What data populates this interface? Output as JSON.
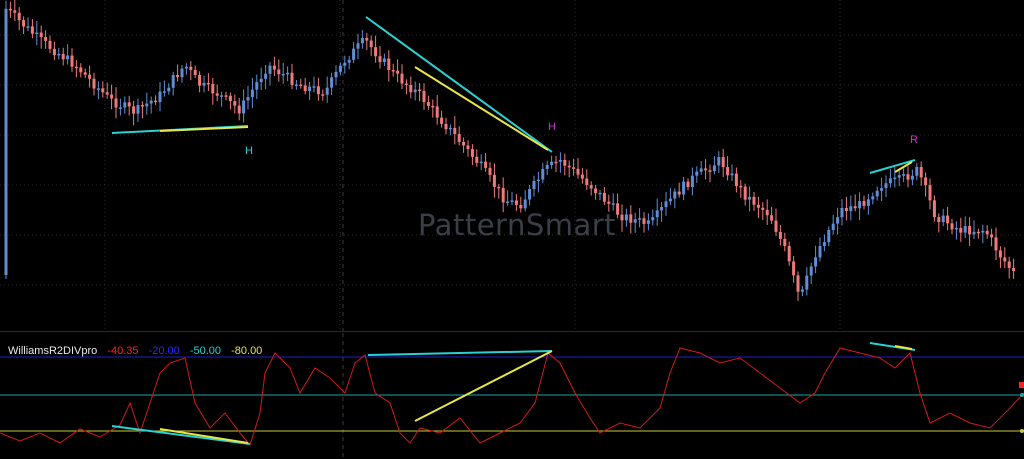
{
  "watermark": "PatternSmart",
  "indicator": {
    "name": "WilliamsR2DIVpro",
    "values": [
      {
        "text": "-40.35",
        "color": "#ff2020"
      },
      {
        "text": "-20.00",
        "color": "#2a2aff"
      },
      {
        "text": "-50.00",
        "color": "#2ad1d1"
      },
      {
        "text": "-80.00",
        "color": "#e6e64a"
      }
    ]
  },
  "colors": {
    "up": "#5f8ed6",
    "down": "#f07a7a",
    "cyan": "#2ad1d1",
    "yellow": "#e6e64a",
    "magenta": "#d02fd0",
    "wr_line": "#d11a1a",
    "level_high": "#1e1ec8",
    "level_mid": "#1aa6a6",
    "level_low": "#c9c93a"
  },
  "chart_data": [
    {
      "type": "candlestick",
      "annotations": [
        {
          "text": "H",
          "color": "#2ad1d1"
        },
        {
          "text": "H",
          "color": "#d02fd0"
        },
        {
          "text": "R",
          "color": "#d02fd0"
        }
      ],
      "divergence_lines": [
        {
          "color": "#2ad1d1",
          "from_bar": 18,
          "to_bar": 40
        },
        {
          "color": "#e6e64a",
          "from_bar": 26,
          "to_bar": 40
        },
        {
          "color": "#2ad1d1",
          "from_bar": 60,
          "to_bar": 90
        },
        {
          "color": "#e6e64a",
          "from_bar": 68,
          "to_bar": 90
        },
        {
          "color": "#2ad1d1",
          "from_bar": 142,
          "to_bar": 150
        },
        {
          "color": "#e6e64a",
          "from_bar": 146,
          "to_bar": 150
        }
      ]
    },
    {
      "type": "line",
      "name": "WilliamsR2DIVpro",
      "ylim": [
        -100,
        0
      ],
      "levels": [
        -20,
        -50,
        -80
      ],
      "last_value": -40.35
    }
  ]
}
